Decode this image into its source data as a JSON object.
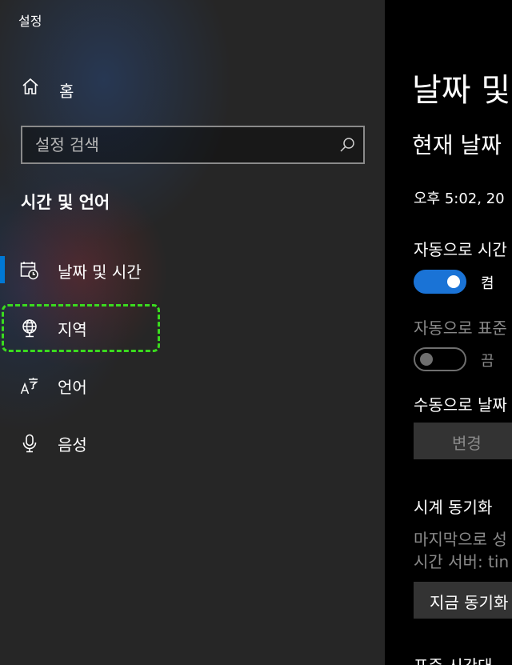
{
  "window": {
    "title": "설정"
  },
  "sidebar": {
    "home_label": "홈",
    "search": {
      "placeholder": "설정 검색"
    },
    "section_title": "시간 및 언어",
    "items": [
      {
        "label": "날짜 및 시간",
        "icon": "calendar-clock-icon",
        "selected": true
      },
      {
        "label": "지역",
        "icon": "globe-icon",
        "selected": false
      },
      {
        "label": "언어",
        "icon": "language-icon",
        "selected": false
      },
      {
        "label": "음성",
        "icon": "microphone-icon",
        "selected": false
      }
    ]
  },
  "main": {
    "heading": "날짜 및",
    "subheading": "현재 날짜",
    "current_datetime": "오후 5:02, 20",
    "auto_time": {
      "label": "자동으로 시간",
      "toggle": "켬",
      "on": true
    },
    "auto_timezone": {
      "label": "자동으로 표준",
      "toggle": "끔",
      "on": false
    },
    "manual": {
      "label": "수동으로 날짜",
      "button": "변경"
    },
    "sync": {
      "title": "시계 동기화",
      "last_sync": "마지막으로 성",
      "server": "시간 서버: tin",
      "button": "지금 동기화"
    },
    "timezone_label": "표준 시간대"
  },
  "colors": {
    "accent": "#0078d4",
    "toggle_on": "#1a73d6",
    "focus_ring": "#3adb1e"
  }
}
